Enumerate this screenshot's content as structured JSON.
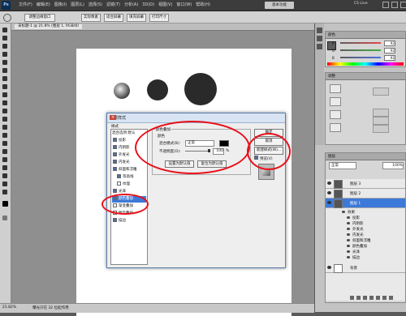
{
  "menubar": {
    "logo": "Ps",
    "items": [
      "文件(F)",
      "编辑(E)",
      "图像(I)",
      "图层(L)",
      "选择(S)",
      "滤镜(T)",
      "分析(A)",
      "3D(D)",
      "视图(V)",
      "窗口(W)",
      "帮助(H)"
    ],
    "workspace_button": "基本功能",
    "cs_live": "CS Live"
  },
  "optbar": {
    "btn1": "调整边缘窗口",
    "btn2": "实际像素",
    "btn3": "适合屏幕",
    "btn4": "填充屏幕",
    "btn5": "打印尺寸"
  },
  "document": {
    "tab_label": "未标题-1 @ 21.8% (图层 1, RGB/8)",
    "zoom": "21.82%",
    "status_info": "曝光只在 32 位起作用"
  },
  "panels": {
    "color_head": "颜色",
    "color_sliders": [
      {
        "label": "R",
        "value": "92",
        "color": "#e24a4a"
      },
      {
        "label": "G",
        "value": "92",
        "color": "#40b040"
      },
      {
        "label": "B",
        "value": "92",
        "color": "#4a70e0"
      }
    ],
    "adjust_head": "调整",
    "layers_head": "图层",
    "blend_mode": "正常",
    "opacity": "100%",
    "layers": [
      {
        "name": "图层 3",
        "selected": false
      },
      {
        "name": "图层 2",
        "selected": false
      },
      {
        "name": "图层 1",
        "selected": true
      }
    ],
    "effects_label": "效果",
    "effects": [
      "投影",
      "内阴影",
      "外发光",
      "内发光",
      "斜面和浮雕",
      "颜色叠加",
      "光泽",
      "描边"
    ],
    "background_layer": "背景"
  },
  "dialog": {
    "title": "图层样式",
    "styles_header": "样式",
    "blend_options": "混合选项:默认",
    "style_items": [
      {
        "label": "投影",
        "checked": true
      },
      {
        "label": "内阴影",
        "checked": true
      },
      {
        "label": "外发光",
        "checked": true
      },
      {
        "label": "内发光",
        "checked": true
      },
      {
        "label": "斜面和浮雕",
        "checked": true
      },
      {
        "label": "等高线",
        "checked": true
      },
      {
        "label": "纹理",
        "checked": false
      },
      {
        "label": "光泽",
        "checked": true
      },
      {
        "label": "颜色叠加",
        "checked": true,
        "selected": true
      },
      {
        "label": "渐变叠加",
        "checked": false
      },
      {
        "label": "图案叠加",
        "checked": false
      },
      {
        "label": "描边",
        "checked": true
      }
    ],
    "section_title": "颜色叠加",
    "subsection": "颜色",
    "blend_mode_label": "混合模式(B):",
    "blend_mode_value": "正常",
    "opacity_label": "不透明度(O):",
    "opacity_value": "100",
    "opacity_unit": "%",
    "opacity_fraction": 1.0,
    "btn_default": "设置为默认值",
    "btn_reset": "复位为默认值",
    "btn_ok": "确定",
    "btn_cancel": "取消",
    "btn_new_style": "新建样式(W)...",
    "preview_label": "预览(V)",
    "overlay_color": "#000000"
  },
  "colors": {
    "annotation": "#e8101a",
    "selection": "#3d79d8"
  }
}
